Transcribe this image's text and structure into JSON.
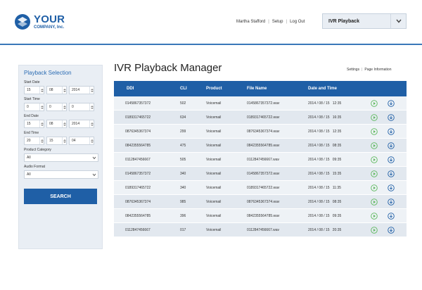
{
  "header": {
    "logo_line1": "YOUR",
    "logo_line2": "COMPANY, Inc.",
    "user_name": "Martha Stafford",
    "setup_label": "Setup",
    "logout_label": "Log Out",
    "app_selected": "IVR Playback",
    "brand_color": "#1f5fa6"
  },
  "sidebar": {
    "title": "Playback Selection",
    "start_date": {
      "label": "Start Date",
      "day": "15",
      "month": "08",
      "year": "2014"
    },
    "start_time": {
      "label": "Start Time",
      "hour": "0",
      "minute": "0",
      "second": "0"
    },
    "end_date": {
      "label": "End Date",
      "day": "15",
      "month": "08",
      "year": "2014"
    },
    "end_time": {
      "label": "End Time",
      "hour": "20",
      "minute": "15",
      "second": "04"
    },
    "product_category": {
      "label": "Product Category",
      "value": "All"
    },
    "audio_format": {
      "label": "Audio Format",
      "value": "All"
    },
    "search_label": "SEARCH"
  },
  "main": {
    "title": "IVR Playback Manager",
    "settings_label": "Settings",
    "page_info_label": "Page Information",
    "columns": [
      "DDI",
      "CLI",
      "Product",
      "File Name",
      "Date and Time"
    ],
    "rows": [
      {
        "ddi": "0145867357372",
        "cli": "502",
        "product": "Voicemail",
        "file": "0145867357372.wav",
        "datetime": "2014 / 08 / 15   12:35"
      },
      {
        "ddi": "0189317465722",
        "cli": "634",
        "product": "Voicemail",
        "file": "0189317465722.wav",
        "datetime": "2014 / 08 / 15   16:35"
      },
      {
        "ddi": "0876345367374",
        "cli": "299",
        "product": "Voicemail",
        "file": "0876345367374.wav",
        "datetime": "2014 / 08 / 15   12:35"
      },
      {
        "ddi": "0842355564785",
        "cli": "475",
        "product": "Voicemail",
        "file": "0842355564785.wav",
        "datetime": "2014 / 08 / 15   08:35"
      },
      {
        "ddi": "0112847456667",
        "cli": "505",
        "product": "Voicemail",
        "file": "0112847456667.wav",
        "datetime": "2014 / 08 / 15   09:35"
      },
      {
        "ddi": "0145867357372",
        "cli": "340",
        "product": "Voicemail",
        "file": "0145867357372.wav",
        "datetime": "2014 / 08 / 15   15:35"
      },
      {
        "ddi": "0189317465722",
        "cli": "340",
        "product": "Voicemail",
        "file": "0189317465722.wav",
        "datetime": "2014 / 08 / 15   11:35"
      },
      {
        "ddi": "0876345367374",
        "cli": "985",
        "product": "Voicemail",
        "file": "0876345367374.wav",
        "datetime": "2014 / 08 / 15   08:35"
      },
      {
        "ddi": "0842355564785",
        "cli": "396",
        "product": "Voicemail",
        "file": "0842355564785.wav",
        "datetime": "2014 / 08 / 15   09:35"
      },
      {
        "ddi": "0112847456667",
        "cli": "017",
        "product": "Voicemail",
        "file": "0112847456667.wav",
        "datetime": "2014 / 08 / 15   20:35"
      }
    ],
    "play_icon": "play-icon",
    "download_icon": "download-icon",
    "play_color": "#5cb85c",
    "download_color": "#1f5fa6"
  }
}
